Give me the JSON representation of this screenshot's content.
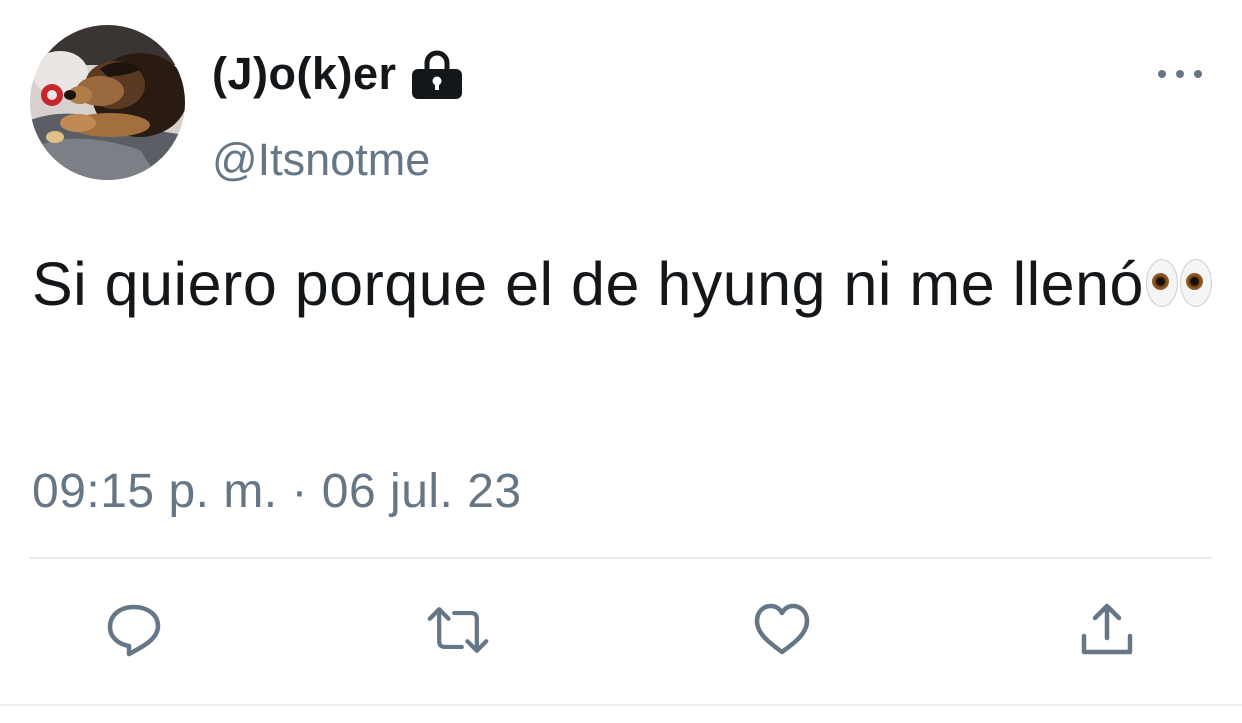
{
  "tweet": {
    "display_name": "(J)o(k)er",
    "username": "@Itsnotme",
    "text": "Si quiero porque el de hyung ni me llenó",
    "timestamp": "09:15 p. m. · 06 jul. 23",
    "protected": true
  },
  "icons": {
    "lock": "lock-icon",
    "more": "more-options-icon",
    "reply": "reply-icon",
    "retweet": "retweet-icon",
    "like": "like-icon",
    "share": "share-icon",
    "emoji": "eyes-emoji"
  },
  "colors": {
    "text_primary": "#14171a",
    "text_secondary": "#657786",
    "divider": "#e6ecf0",
    "background": "#ffffff"
  }
}
